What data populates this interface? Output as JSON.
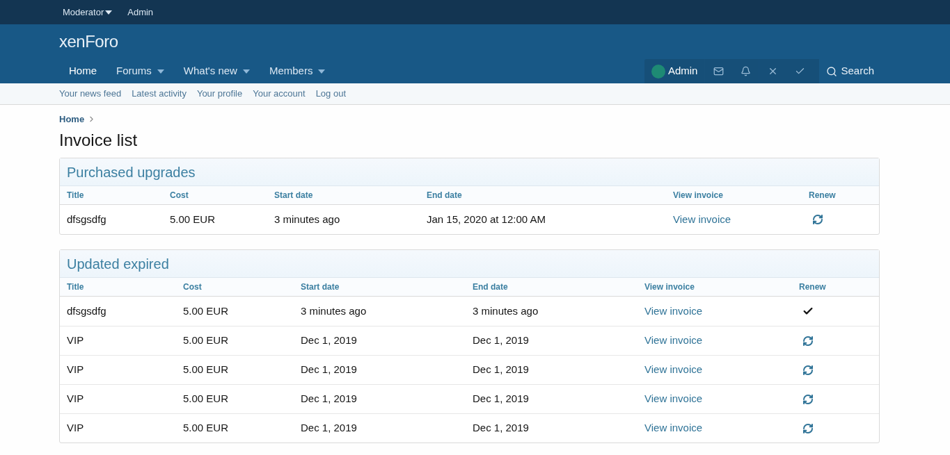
{
  "staff_bar": [
    {
      "label": "Moderator",
      "has_menu": true
    },
    {
      "label": "Admin",
      "has_menu": false
    }
  ],
  "logo": {
    "part_1": "xen",
    "part_2": "Foro"
  },
  "nav": [
    {
      "label": "Home",
      "has_menu": false,
      "selected": true
    },
    {
      "label": "Forums",
      "has_menu": true,
      "selected": false
    },
    {
      "label": "What's new",
      "has_menu": true,
      "selected": false
    },
    {
      "label": "Members",
      "has_menu": true,
      "selected": false
    }
  ],
  "user_nav": {
    "username": "Admin",
    "search": "Search"
  },
  "sub_nav": [
    "Your news feed",
    "Latest activity",
    "Your profile",
    "Your account",
    "Log out"
  ],
  "breadcrumb": [
    "Home"
  ],
  "page_title": "Invoice list",
  "blocks": [
    {
      "title": "Purchased upgrades",
      "columns": [
        "Title",
        "Cost",
        "Start date",
        "End date",
        "View invoice",
        "Renew"
      ],
      "rows": [
        {
          "title": "dfsgsdfg",
          "cost": "5.00 EUR",
          "start": "3 minutes ago",
          "end": "Jan 15, 2020 at 12:00 AM",
          "link": "View invoice",
          "kind": "renew"
        }
      ]
    },
    {
      "title": "Updated expired",
      "columns": [
        "Title",
        "Cost",
        "Start date",
        "End date",
        "View invoice",
        "Renew"
      ],
      "rows": [
        {
          "title": "dfsgsdfg",
          "cost": "5.00 EUR",
          "start": "3 minutes ago",
          "end": "3 minutes ago",
          "link": "View invoice",
          "kind": "done"
        },
        {
          "title": "VIP",
          "cost": "5.00 EUR",
          "start": "Dec 1, 2019",
          "end": "Dec 1, 2019",
          "link": "View invoice",
          "kind": "renew"
        },
        {
          "title": "VIP",
          "cost": "5.00 EUR",
          "start": "Dec 1, 2019",
          "end": "Dec 1, 2019",
          "link": "View invoice",
          "kind": "renew"
        },
        {
          "title": "VIP",
          "cost": "5.00 EUR",
          "start": "Dec 1, 2019",
          "end": "Dec 1, 2019",
          "link": "View invoice",
          "kind": "renew"
        },
        {
          "title": "VIP",
          "cost": "5.00 EUR",
          "start": "Dec 1, 2019",
          "end": "Dec 1, 2019",
          "link": "View invoice",
          "kind": "renew"
        }
      ]
    }
  ]
}
